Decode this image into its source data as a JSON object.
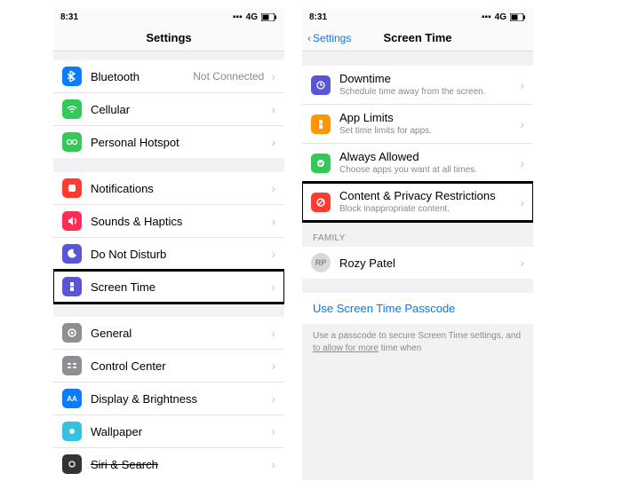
{
  "status": {
    "time": "8:31",
    "net": "4G"
  },
  "left": {
    "title": "Settings",
    "rows": [
      {
        "label": "Bluetooth",
        "value": "Not Connected"
      },
      {
        "label": "Cellular"
      },
      {
        "label": "Personal Hotspot"
      },
      {
        "label": "Notifications"
      },
      {
        "label": "Sounds & Haptics"
      },
      {
        "label": "Do Not Disturb"
      },
      {
        "label": "Screen Time"
      },
      {
        "label": "General"
      },
      {
        "label": "Control Center"
      },
      {
        "label": "Display & Brightness"
      },
      {
        "label": "Wallpaper"
      },
      {
        "label": "Siri & Search"
      }
    ]
  },
  "right": {
    "back": "Settings",
    "title": "Screen Time",
    "rows": [
      {
        "label": "Downtime",
        "sub": "Schedule time away from the screen."
      },
      {
        "label": "App Limits",
        "sub": "Set time limits for apps."
      },
      {
        "label": "Always Allowed",
        "sub": "Choose apps you want at all times."
      },
      {
        "label": "Content & Privacy Restrictions",
        "sub": "Block inappropriate content."
      }
    ],
    "family_header": "FAMILY",
    "family": [
      {
        "initials": "RP",
        "name": "Rozy Patel"
      }
    ],
    "link": "Use Screen Time Passcode",
    "footer_a": "Use a passcode to secure Screen Time settings, and ",
    "footer_b": "to allow for more",
    "footer_c": " time when"
  }
}
